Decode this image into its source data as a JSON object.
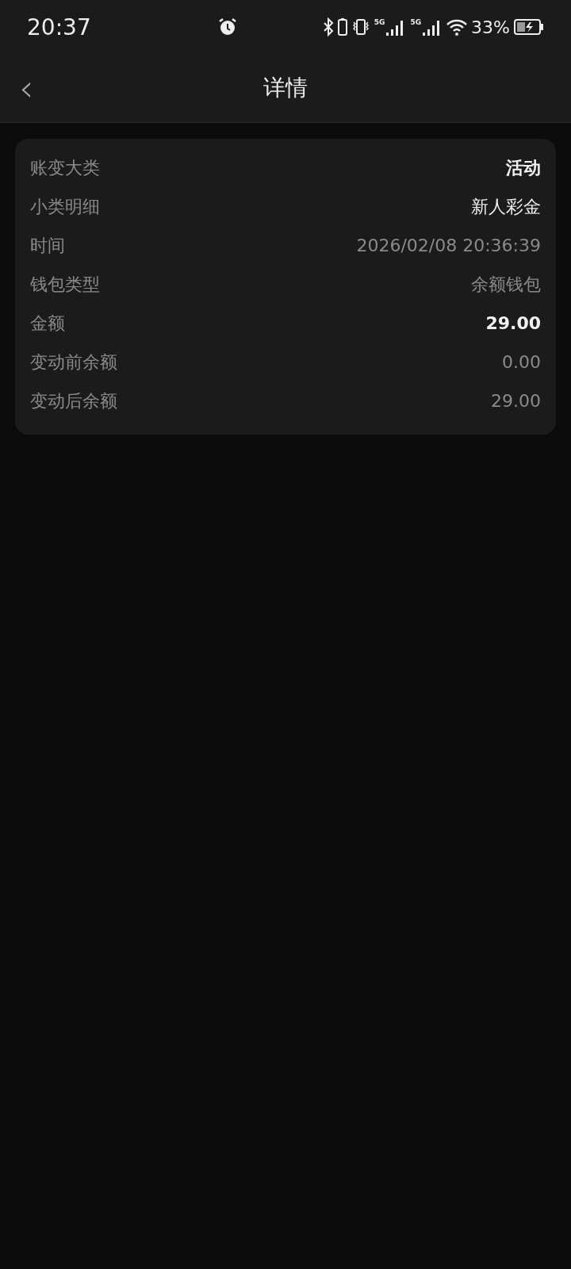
{
  "status_bar": {
    "time": "20:37",
    "network_labels": [
      "5G",
      "5G"
    ],
    "battery_percent": "33%"
  },
  "header": {
    "title": "详情",
    "back": "‹"
  },
  "details": [
    {
      "label": "账变大类",
      "value": "活动",
      "kind": "strong"
    },
    {
      "label": "小类明细",
      "value": "新人彩金",
      "kind": "bright"
    },
    {
      "label": "时间",
      "value": "2026/02/08 20:36:39",
      "kind": "muted"
    },
    {
      "label": "钱包类型",
      "value": "余额钱包",
      "kind": "muted"
    },
    {
      "label": "金额",
      "value": "29.00",
      "kind": "strong"
    },
    {
      "label": "变动前余额",
      "value": "0.00",
      "kind": "muted"
    },
    {
      "label": "变动后余额",
      "value": "29.00",
      "kind": "muted"
    }
  ]
}
